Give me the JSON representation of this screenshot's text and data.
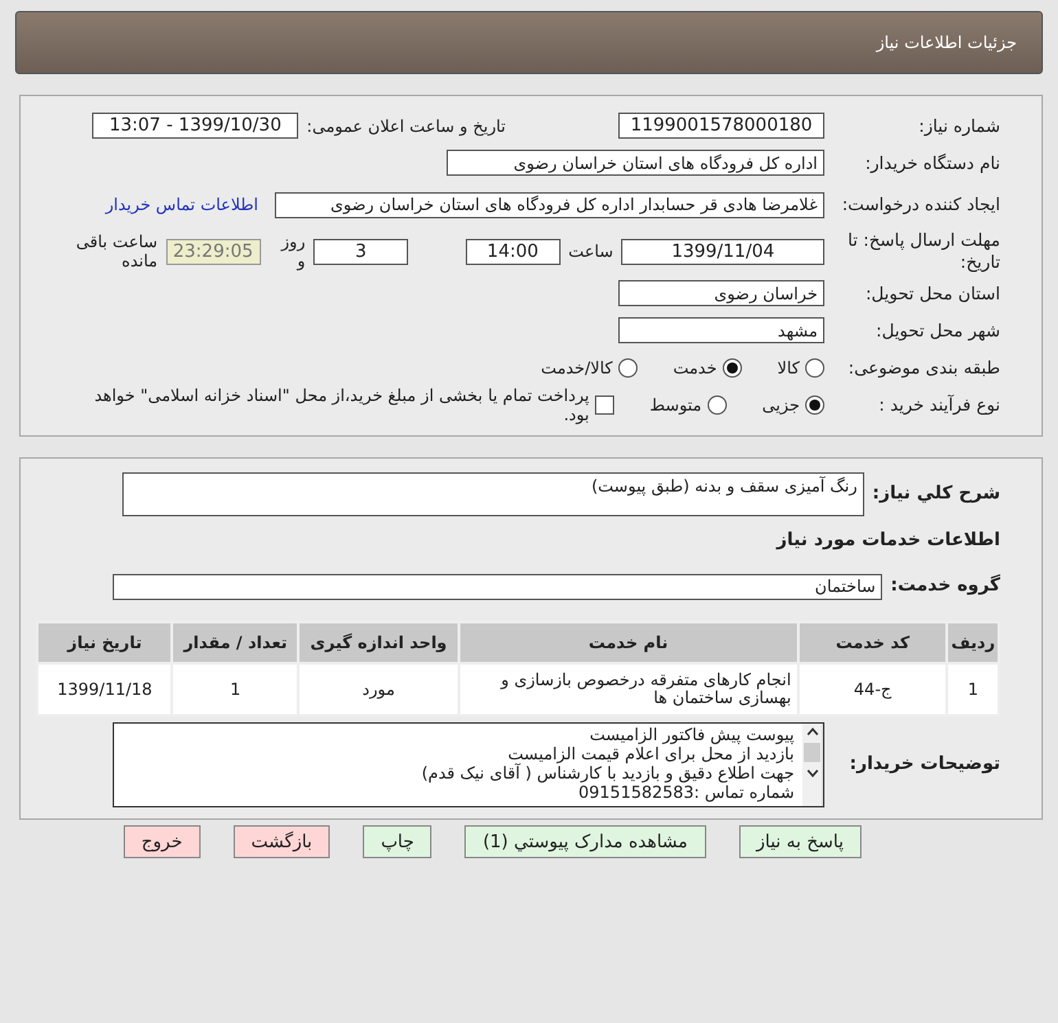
{
  "header": {
    "title": "جزئیات اطلاعات نیاز"
  },
  "need_number": {
    "label": "شماره نیاز:",
    "value": "1199001578000180"
  },
  "announce": {
    "label": "تاریخ و ساعت اعلان عمومی:",
    "value": "1399/10/30 - 13:07"
  },
  "buyer": {
    "label": "نام دستگاه خریدار:",
    "value": "اداره کل فرودگاه های استان خراسان رضوی"
  },
  "creator": {
    "label": "ایجاد کننده درخواست:",
    "value": "غلامرضا هادی قر حسابدار اداره کل فرودگاه های استان خراسان رضوی",
    "link": "اطلاعات تماس خریدار"
  },
  "deadline": {
    "label": "مهلت ارسال پاسخ: تا تاریخ:",
    "date": "1399/11/04",
    "time_label": "ساعت",
    "time": "14:00",
    "days": "3",
    "days_label": "روز و",
    "remaining": "23:29:05",
    "remaining_label": "ساعت باقی مانده"
  },
  "province": {
    "label": "استان محل تحویل:",
    "value": "خراسان رضوی"
  },
  "city": {
    "label": "شهر محل تحویل:",
    "value": "مشهد"
  },
  "category": {
    "label": "طبقه بندی موضوعی:",
    "options": [
      {
        "label": "کالا",
        "selected": false
      },
      {
        "label": "خدمت",
        "selected": true
      },
      {
        "label": "کالا/خدمت",
        "selected": false
      }
    ]
  },
  "process": {
    "label": "نوع فرآیند خرید :",
    "options": [
      {
        "label": "جزیی",
        "selected": true
      },
      {
        "label": "متوسط",
        "selected": false
      }
    ],
    "payment": {
      "checked": false,
      "label": "پرداخت تمام یا بخشی از مبلغ خرید،از محل \"اسناد خزانه اسلامی\" خواهد بود."
    }
  },
  "summary": {
    "label": "شرح کلي نياز:",
    "value": "رنگ آمیزی سقف و بدنه (طبق پیوست)"
  },
  "services_heading": "اطلاعات خدمات مورد نیاز",
  "service_group": {
    "label": "گروه خدمت:",
    "value": "ساختمان"
  },
  "table": {
    "columns": [
      "ردیف",
      "کد خدمت",
      "نام خدمت",
      "واحد اندازه گیری",
      "تعداد / مقدار",
      "تاریخ نیاز"
    ],
    "rows": [
      [
        "1",
        "ج-44",
        "انجام کارهای متفرقه درخصوص بازسازی و بهسازی ساختمان ها",
        "مورد",
        "1",
        "1399/11/18"
      ]
    ]
  },
  "notes": {
    "label": "توضیحات خریدار:",
    "lines": [
      "پیوست پیش فاکتور الزامیست",
      "بازدید از محل برای اعلام قیمت الزامیست",
      "جهت اطلاع دقیق و بازدید با کارشناس  ( آقای نیک قدم)",
      "شماره تماس :09151582583"
    ]
  },
  "buttons": [
    {
      "label": "پاسخ به نیاز",
      "kind": "normal"
    },
    {
      "label": "مشاهده مدارک پیوستي (1)",
      "kind": "normal"
    },
    {
      "label": "چاپ",
      "kind": "normal"
    },
    {
      "label": "بازگشت",
      "kind": "danger"
    },
    {
      "label": "خروج",
      "kind": "danger"
    }
  ]
}
